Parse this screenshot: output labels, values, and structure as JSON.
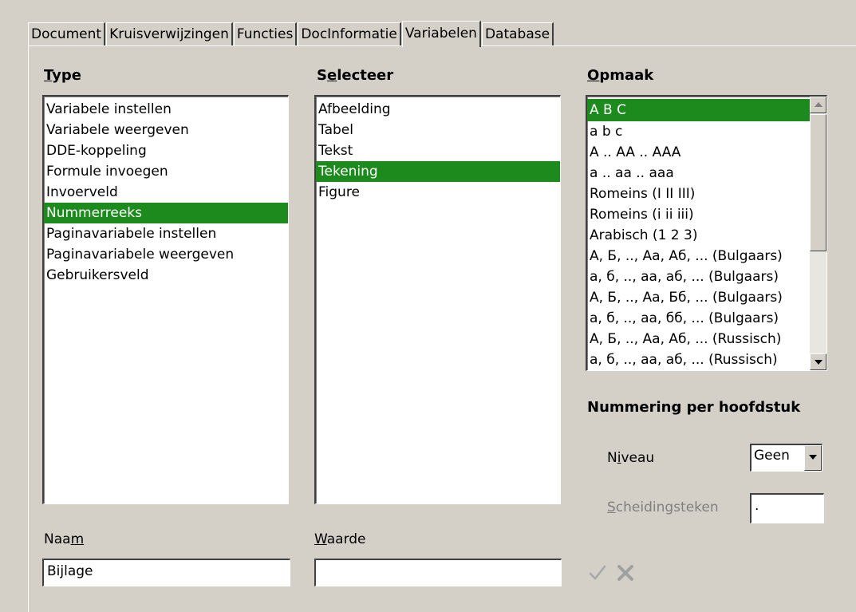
{
  "tabs": [
    {
      "label": "Document"
    },
    {
      "label": "Kruisverwijzingen"
    },
    {
      "label": "Functies"
    },
    {
      "label": "DocInformatie"
    },
    {
      "label": "Variabelen"
    },
    {
      "label": "Database"
    }
  ],
  "active_tab": "Variabelen",
  "type": {
    "heading_mnemonic": "T",
    "heading_rest": "ype",
    "items": [
      "Variabele instellen",
      "Variabele weergeven",
      "DDE-koppeling",
      "Formule invoegen",
      "Invoerveld",
      "Nummerreeks",
      "Paginavariabele instellen",
      "Paginavariabele weergeven",
      "Gebruikersveld"
    ],
    "selected": "Nummerreeks"
  },
  "selecteer": {
    "heading_pre": "S",
    "heading_mnemonic": "e",
    "heading_rest": "lecteer",
    "items": [
      "Afbeelding",
      "Tabel",
      "Tekst",
      "Tekening",
      "Figure"
    ],
    "selected": "Tekening"
  },
  "opmaak": {
    "heading_mnemonic": "O",
    "heading_rest": "pmaak",
    "items": [
      "A B C",
      "a b c",
      "A .. AA .. AAA",
      "a .. aa .. aaa",
      "Romeins (I II III)",
      "Romeins (i ii iii)",
      "Arabisch (1 2 3)",
      "А, Б, .., Аа, Аб, ... (Bulgaars)",
      "а, б, .., аа, аб, ... (Bulgaars)",
      "А, Б, .., Аа, Бб, ... (Bulgaars)",
      "а, б, .., аа, бб, ... (Bulgaars)",
      "А, Б, .., Аа, Аб, ... (Russisch)",
      "а, б, .., аа, аб, ... (Russisch)"
    ],
    "selected": "A B C"
  },
  "chapter": {
    "heading": "Nummering per hoofdstuk",
    "niveau_pre": "N",
    "niveau_mnemonic": "i",
    "niveau_rest": "veau",
    "niveau_value": "Geen",
    "sep_mnemonic": "S",
    "sep_rest": "cheidingsteken",
    "sep_value": "."
  },
  "naam": {
    "label_pre": "Naa",
    "label_mnemonic": "m",
    "value": "Bijlage"
  },
  "waarde": {
    "label_mnemonic": "W",
    "label_rest": "aarde",
    "value": ""
  },
  "icons": {
    "apply": "check-icon",
    "cancel": "cross-icon"
  },
  "colors": {
    "selection": "#1c8a1c",
    "background": "#d4d0c8"
  }
}
